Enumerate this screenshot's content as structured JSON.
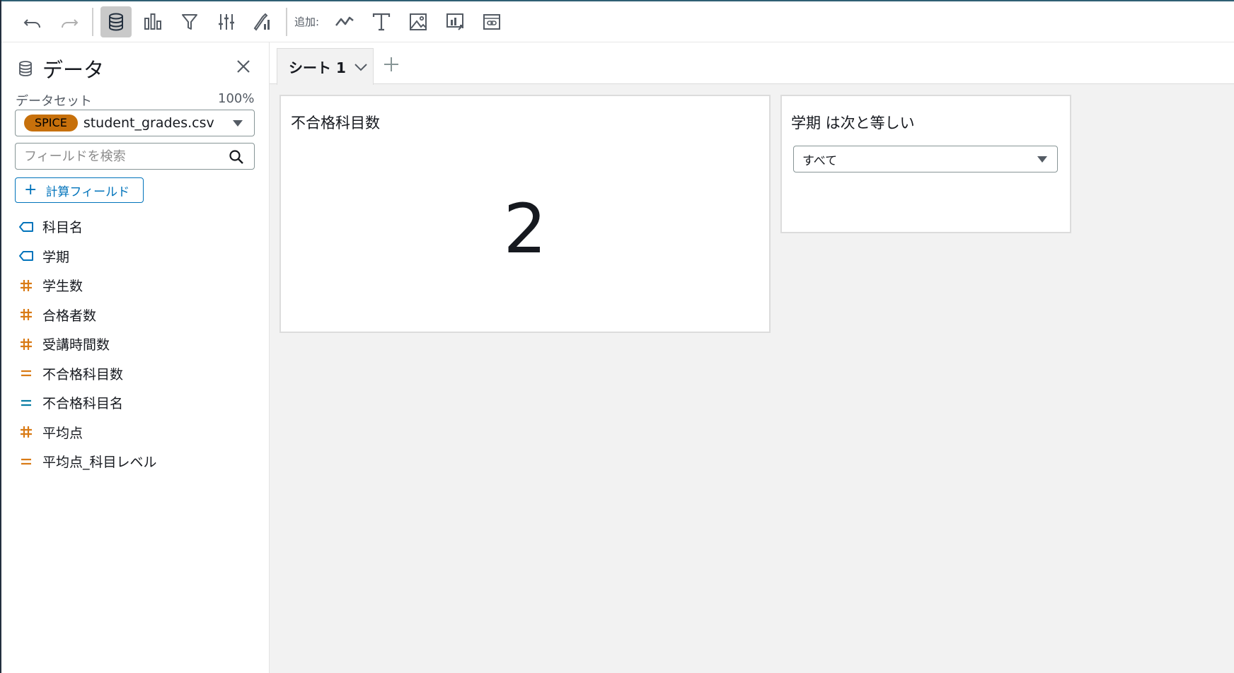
{
  "toolbar": {
    "add_label": "追加:",
    "icons": [
      "undo-icon",
      "redo-icon",
      "dataset-icon",
      "chart-icon",
      "filter-icon",
      "parameters-icon",
      "insights-icon",
      "line-chart-icon",
      "text-icon",
      "image-icon",
      "embed-visual-icon",
      "link-icon"
    ]
  },
  "panel": {
    "title": "データ",
    "dataset_label": "データセット",
    "dataset_percent": "100%",
    "spice_badge": "SPICE",
    "dataset_name": "student_grades.csv",
    "search_placeholder": "フィールドを検索",
    "calc_field_label": "計算フィールド",
    "fields": [
      {
        "name": "科目名",
        "type": "dimension",
        "color": "#0073bb"
      },
      {
        "name": "学期",
        "type": "dimension",
        "color": "#0073bb"
      },
      {
        "name": "学生数",
        "type": "measure",
        "color": "#d97b16"
      },
      {
        "name": "合格者数",
        "type": "measure",
        "color": "#d97b16"
      },
      {
        "name": "受講時間数",
        "type": "measure",
        "color": "#d97b16"
      },
      {
        "name": "不合格科目数",
        "type": "calculated-measure",
        "color": "#d97b16"
      },
      {
        "name": "不合格科目名",
        "type": "calculated-dimension",
        "color": "#0a7ea4"
      },
      {
        "name": "平均点",
        "type": "measure",
        "color": "#d97b16"
      },
      {
        "name": "平均点_科目レベル",
        "type": "calculated-measure",
        "color": "#d97b16"
      }
    ]
  },
  "sheet": {
    "tab_label": "シート 1"
  },
  "kpi": {
    "title": "不合格科目数",
    "value": "2"
  },
  "filter_control": {
    "title": "学期 は次と等しい",
    "value": "すべて"
  },
  "colors": {
    "spice": "#c7700b",
    "accent": "#0073bb",
    "measure": "#d97b16"
  }
}
